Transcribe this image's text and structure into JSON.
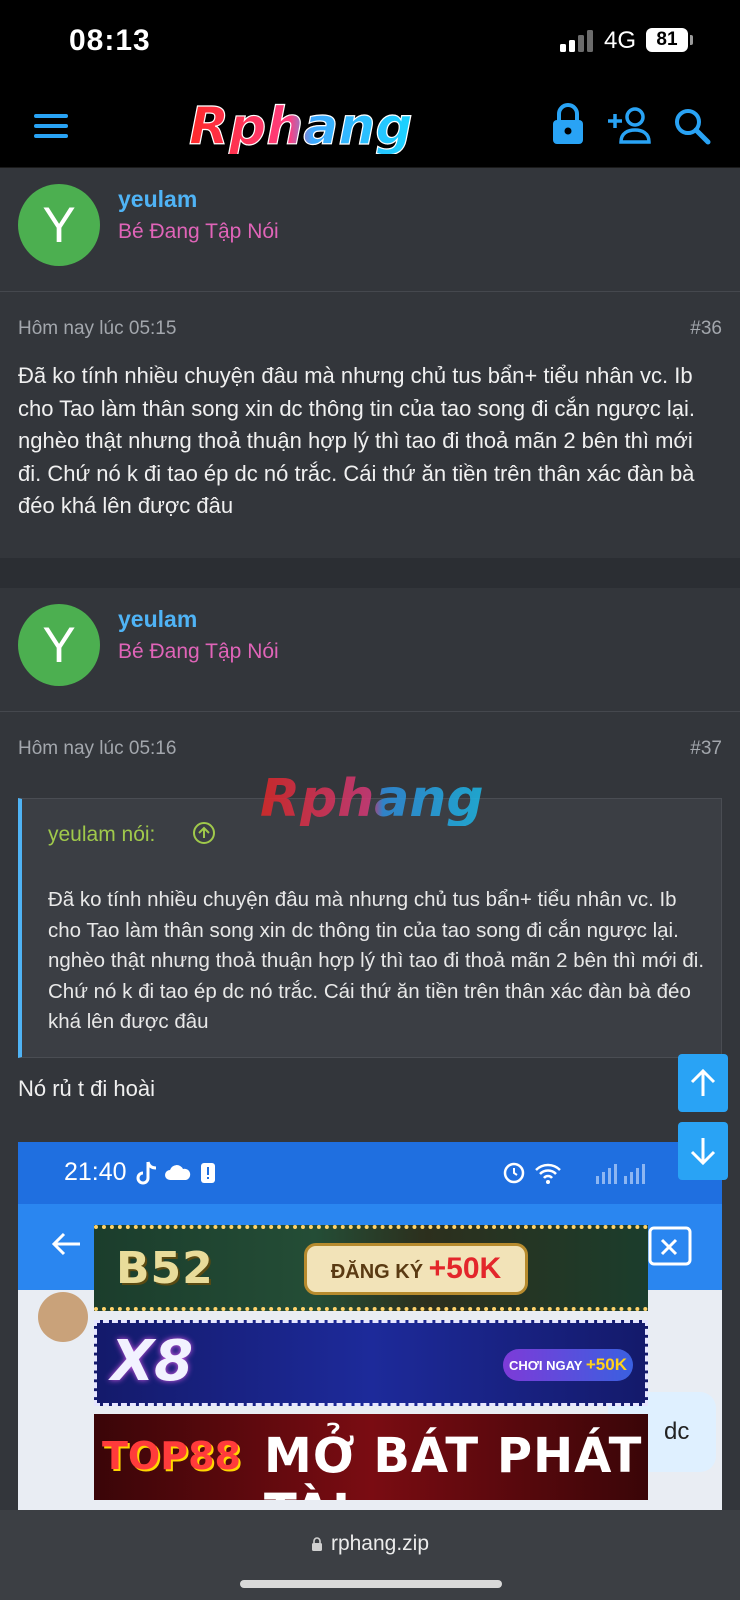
{
  "status": {
    "time": "08:13",
    "network": "4G",
    "battery": "81"
  },
  "header": {
    "logo_text": "Rphang"
  },
  "posts": [
    {
      "username": "yeulam",
      "user_title": "Bé Đang Tập Nói",
      "avatar_letter": "Y",
      "date": "Hôm nay lúc 05:15",
      "number": "#36",
      "body": "Đã ko tính nhiều chuyện đâu mà nhưng chủ tus bẩn+ tiểu nhân vc. Ib cho Tao làm thân song xin dc thông tin của tao song đi cắn ngược lại. nghèo thật nhưng thoả thuận hợp lý thì tao đi thoả mãn 2 bên thì mới đi. Chứ nó k đi tao ép dc nó trắc. Cái thứ ăn tiền trên thân xác đàn bà đéo khá lên được đâu"
    },
    {
      "username": "yeulam",
      "user_title": "Bé Đang Tập Nói",
      "avatar_letter": "Y",
      "date": "Hôm nay lúc 05:16",
      "number": "#37",
      "quote_author": "yeulam nói:",
      "quote_body": "Đã ko tính nhiều chuyện đâu mà nhưng chủ tus bẩn+ tiểu nhân vc. Ib cho Tao làm thân song xin dc thông tin của tao song đi cắn ngược lại. nghèo thật nhưng thoả thuận hợp lý thì tao đi thoả mãn 2 bên thì mới đi. Chứ nó k đi tao ép dc nó trắc. Cái thứ ăn tiền trên thân xác đàn bà đéo khá lên được đâu",
      "reply": "Nó rủ t đi hoài",
      "embedded": {
        "time": "21:40",
        "bubble_text": "dc"
      }
    }
  ],
  "ads": [
    {
      "brand": "B52",
      "cta_prefix": "ĐĂNG KÝ",
      "cta_amount": "+50K"
    },
    {
      "brand": "X8",
      "cta_prefix": "CHƠI NGAY",
      "cta_amount": "+50K"
    },
    {
      "brand": "TOP88",
      "slogan": "MỞ BÁT PHÁT TÀI"
    }
  ],
  "browser": {
    "url": "rphang.zip"
  },
  "colors": {
    "accent": "#29a3f5",
    "username": "#4fb3f5",
    "user_title": "#e064b8",
    "quote_author": "#a0c94b",
    "avatar": "#4caf50"
  }
}
